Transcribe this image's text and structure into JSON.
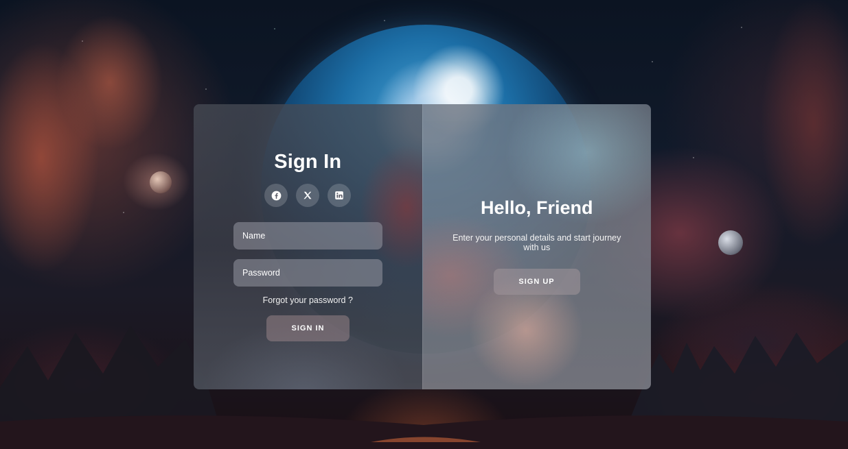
{
  "signin": {
    "title": "Sign In",
    "socials": [
      {
        "icon": "facebook-icon"
      },
      {
        "icon": "x-icon"
      },
      {
        "icon": "linkedin-icon"
      }
    ],
    "name_placeholder": "Name",
    "password_placeholder": "Password",
    "forgot_label": "Forgot your password ?",
    "button_label": "SIGN IN"
  },
  "signup": {
    "title": "Hello, Friend",
    "text": "Enter your personal details and start journey with us",
    "button_label": "SIGN UP"
  },
  "colors": {
    "panel_text": "#ffffff",
    "planet": "#1c6ea6",
    "rock_accent": "#b8553e"
  }
}
